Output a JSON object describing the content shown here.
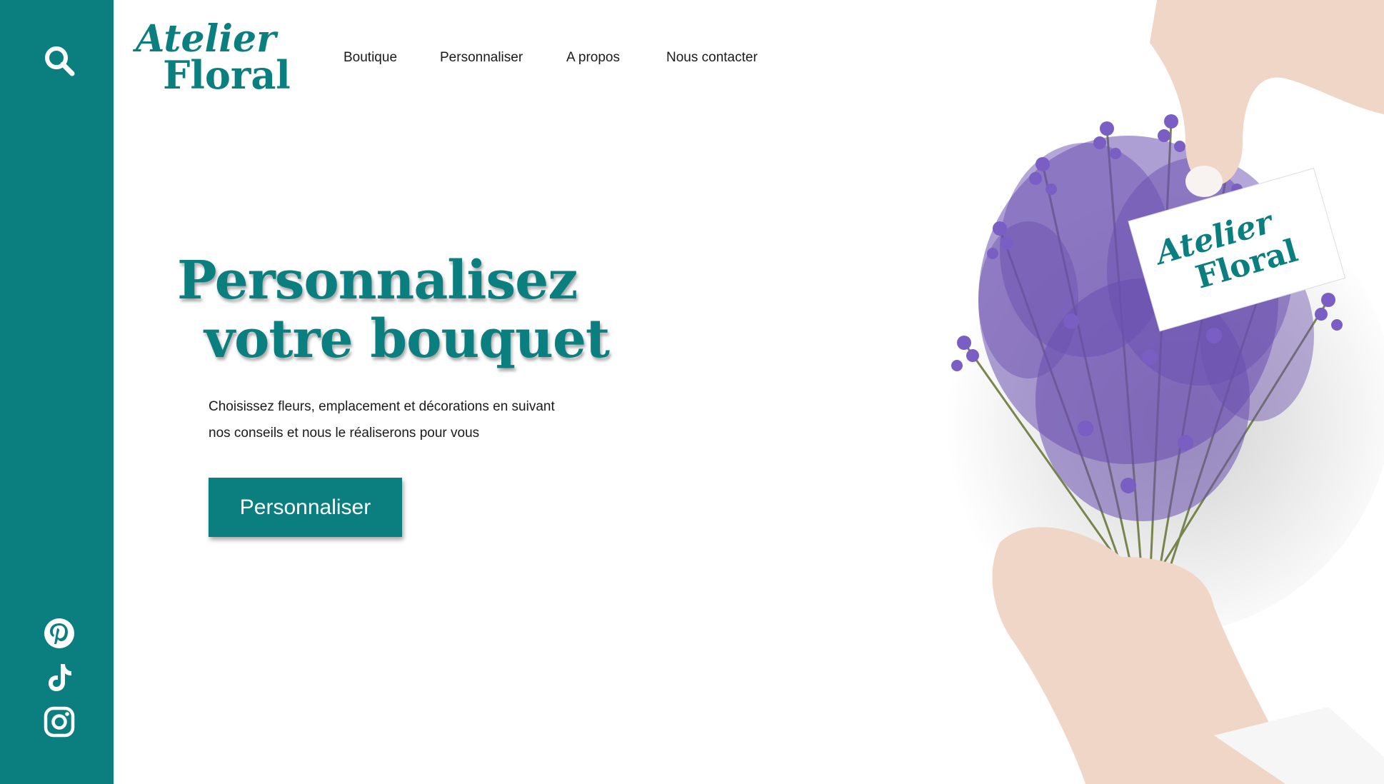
{
  "brand": {
    "line1": "Atelier",
    "line2": "Floral",
    "color": "#0b7f7f"
  },
  "nav": [
    {
      "label": "Boutique"
    },
    {
      "label": "Personnaliser"
    },
    {
      "label": "A propos"
    },
    {
      "label": "Nous contacter"
    }
  ],
  "hero": {
    "title_line1": "Personnalisez",
    "title_line2": "votre bouquet",
    "subtitle_line1": "Choisissez fleurs, emplacement et décorations en suivant",
    "subtitle_line2": "nos conseils et nous le réaliserons pour vous",
    "cta_label": "Personnaliser"
  },
  "card": {
    "line1": "Atelier",
    "line2": "Floral"
  },
  "icons": {
    "search": "search-icon",
    "social": [
      "pinterest-icon",
      "tiktok-icon",
      "instagram-icon"
    ]
  },
  "colors": {
    "accent": "#0b7f7f",
    "text": "#1a1a1a",
    "lavender": "#6a4fb0"
  }
}
